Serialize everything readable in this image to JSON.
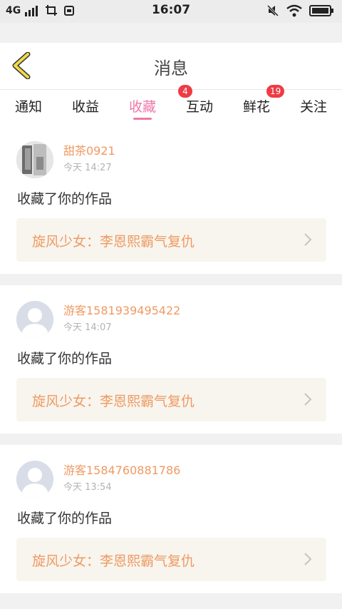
{
  "statusbar": {
    "network": "4G",
    "time": "16:07"
  },
  "header": {
    "title": "消息"
  },
  "tabs": [
    {
      "label": "通知",
      "badge": ""
    },
    {
      "label": "收益",
      "badge": ""
    },
    {
      "label": "收藏",
      "badge": "4"
    },
    {
      "label": "互动",
      "badge": ""
    },
    {
      "label": "鲜花",
      "badge": "19"
    },
    {
      "label": "关注",
      "badge": ""
    }
  ],
  "active_tab": "收藏",
  "items": [
    {
      "username": "甜茶0921",
      "time": "今天 14:27",
      "action": "收藏了你的作品",
      "work_title": "旋风少女：李恩熙霸气复仇"
    },
    {
      "username": "游客1581939495422",
      "time": "今天 14:07",
      "action": "收藏了你的作品",
      "work_title": "旋风少女：李恩熙霸气复仇"
    },
    {
      "username": "游客1584760881786",
      "time": "今天 13:54",
      "action": "收藏了你的作品",
      "work_title": "旋风少女：李恩熙霸气复仇"
    }
  ],
  "colors": {
    "accent_pink": "#ef77a8",
    "accent_orange": "#ef9a63",
    "badge_red": "#ee3b45",
    "back_arrow": "#f1d84a"
  }
}
